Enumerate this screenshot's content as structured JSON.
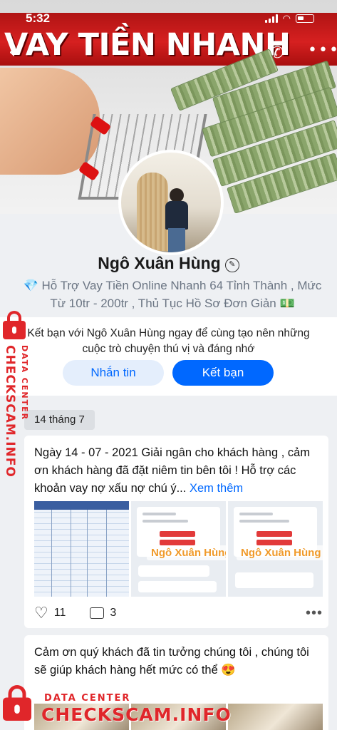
{
  "status_bar": {
    "time": "5:32"
  },
  "cover": {
    "banner_text": "VAY TIỀN NHANH"
  },
  "profile": {
    "name": "Ngô Xuân Hùng",
    "bio_line1": "Hỗ Trợ Vay Tiền Online Nhanh 64 Tỉnh Thành , Mức",
    "bio_line2": "Từ 10tr - 200tr , Thủ Tục Hồ Sơ Đơn Giản"
  },
  "add_friend": {
    "text": "Kết bạn với Ngô Xuân Hùng ngay để cùng tạo nên những cuộc trò chuyện thú vị và đáng nhớ",
    "message_button": "Nhắn tin",
    "add_button": "Kết bạn"
  },
  "feed": {
    "date_chip": "14 tháng 7",
    "posts": [
      {
        "text": "Ngày 14 - 07 - 2021 Giải ngân cho khách hàng , cảm ơn khách hàng đã đặt niêm tin bên tôi ! Hỗ trợ các khoản vay nợ xấu nợ chú ý...",
        "more_label": "Xem thêm",
        "overlay_name": "Ngô Xuân Hùng",
        "likes": "11",
        "comments": "3"
      },
      {
        "text": "Cảm ơn quý khách đã tin tưởng chúng tôi , chúng tôi sẽ giúp khách hàng hết mức có thể 😍"
      }
    ]
  },
  "watermark": {
    "vertical_small": "DATA CENTER",
    "vertical_big": "CHECKSCAM.INFO",
    "bottom_small": "DATA CENTER",
    "bottom_big": "CHECKSCAM.INFO"
  },
  "colors": {
    "accent": "#0068ff",
    "watermark": "#e0262a",
    "banner": "#c81a1a"
  },
  "icons": [
    "back-icon",
    "phone-icon",
    "more-icon",
    "edit-icon",
    "heart-icon",
    "comment-icon",
    "lock-icon"
  ]
}
